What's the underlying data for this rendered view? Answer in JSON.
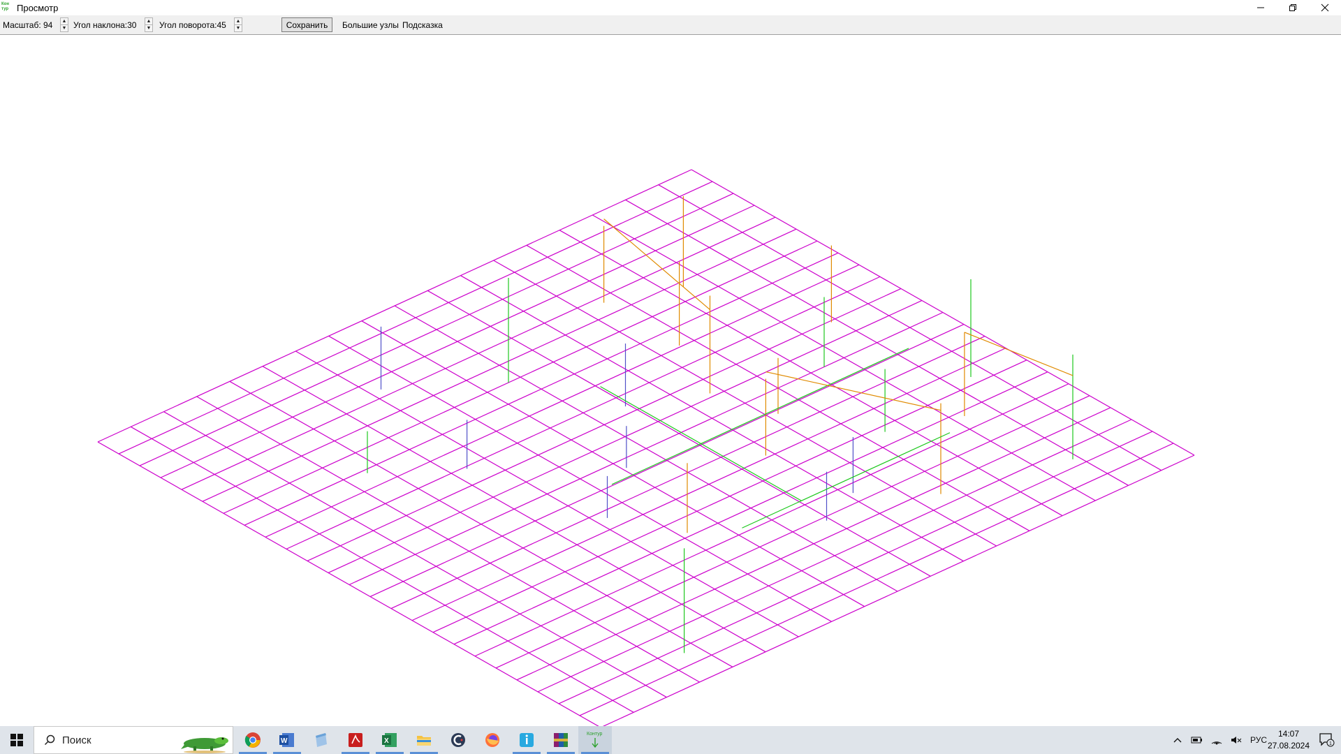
{
  "window": {
    "title": "Просмотр",
    "icon_text_top": "Кон",
    "icon_text_bottom": "тур",
    "minimize_icon": "minimize-icon",
    "restore_icon": "restore-icon",
    "close_icon": "close-icon"
  },
  "toolbar": {
    "scale_label": "Масштаб: 94",
    "tilt_label": "Угол наклона:30",
    "rotation_label": "Угол поворота:45",
    "save_label": "Сохранить",
    "big_nodes_label": "Большие узлы",
    "hint_label": "Подсказка"
  },
  "colors": {
    "grid_lines": "#cc00cc",
    "risers_green": "#1ec81e",
    "risers_orange": "#e08a00",
    "risers_blue": "#5050c8",
    "details_dark": "#202060"
  },
  "taskbar": {
    "search_placeholder": "Поиск",
    "apps": [
      "Chrome",
      "Word",
      "Notepad",
      "Acrobat",
      "Excel",
      "Explorer",
      "CCleaner",
      "Firefox",
      "Info",
      "WinRAR",
      "Контур"
    ],
    "active_app_label": "Контур",
    "language": "РУС",
    "time": "14:07",
    "date": "27.08.2024",
    "notification_count": "1"
  }
}
